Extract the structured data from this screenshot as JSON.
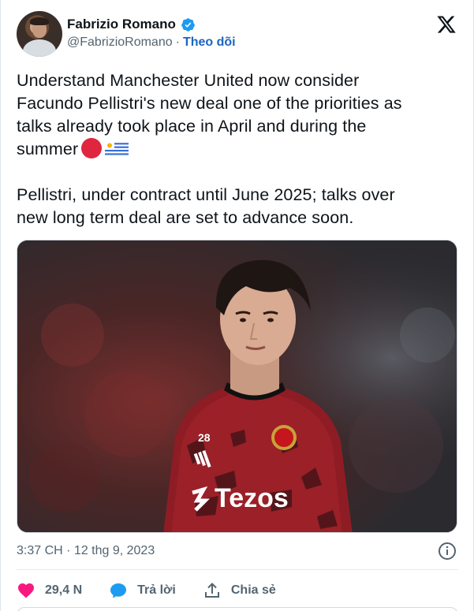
{
  "author": {
    "display_name": "Fabrizio Romano",
    "handle": "@FabrizioRomano",
    "separator": "·",
    "follow_label": "Theo dõi"
  },
  "icons": {
    "verified": "verified-badge-icon",
    "platform": "x-logo-icon",
    "info": "info-icon",
    "like": "heart-icon",
    "reply": "reply-bubble-icon",
    "share": "share-upload-icon"
  },
  "tweet": {
    "paragraph1": "Understand Manchester United now consider\nFacundo Pellistri's new deal one of the priorities as\ntalks already took place in April and during the\nsummer",
    "paragraph2": "Pellistri, under contract until June 2025; talks over\nnew long term deal are set to advance soon."
  },
  "media": {
    "jersey_number": "28",
    "sponsor": "Tezos"
  },
  "meta": {
    "timestamp": "3:37 CH · 12 thg 9, 2023"
  },
  "actions": {
    "likes": "29,4 N",
    "reply_label": "Trả lời",
    "share_label": "Chia sẻ"
  },
  "colors": {
    "like_red": "#f91880",
    "reply_blue": "#1d9bf0",
    "follow_blue": "#1d65c1",
    "verified_blue": "#1d9bf0",
    "muted_text": "#536471",
    "text": "#0f1419"
  }
}
